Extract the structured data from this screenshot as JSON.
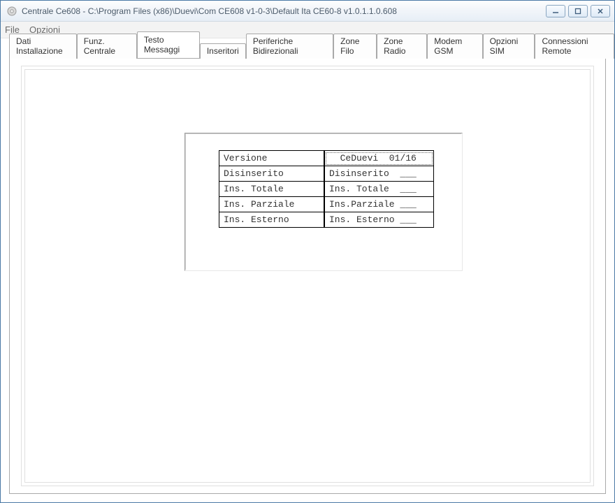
{
  "window": {
    "title": "Centrale Ce608 - C:\\Program Files (x86)\\Duevi\\Com CE608 v1-0-3\\Default Ita CE60-8 v1.0.1.1.0.608"
  },
  "menu": {
    "file": "File",
    "opzioni": "Opzioni"
  },
  "tabs": [
    {
      "id": "dati-installazione",
      "label": "Dati Installazione"
    },
    {
      "id": "funz-centrale",
      "label": "Funz. Centrale"
    },
    {
      "id": "testo-messaggi",
      "label": "Testo Messaggi"
    },
    {
      "id": "inseritori",
      "label": "Inseritori"
    },
    {
      "id": "periferiche-bidi",
      "label": "Periferiche Bidirezionali"
    },
    {
      "id": "zone-filo",
      "label": "Zone Filo"
    },
    {
      "id": "zone-radio",
      "label": "Zone Radio"
    },
    {
      "id": "modem-gsm",
      "label": "Modem GSM"
    },
    {
      "id": "opzioni-sim",
      "label": "Opzioni SIM"
    },
    {
      "id": "connessioni-remote",
      "label": "Connessioni Remote"
    }
  ],
  "active_tab_id": "testo-messaggi",
  "messages": {
    "rows": [
      {
        "label": "Versione",
        "value": "  CeDuevi  01/16"
      },
      {
        "label": "Disinserito",
        "value": "Disinserito  ___"
      },
      {
        "label": "Ins. Totale",
        "value": "Ins. Totale  ___"
      },
      {
        "label": "Ins. Parziale",
        "value": "Ins.Parziale ___"
      },
      {
        "label": "Ins. Esterno",
        "value": "Ins. Esterno ___"
      }
    ]
  }
}
